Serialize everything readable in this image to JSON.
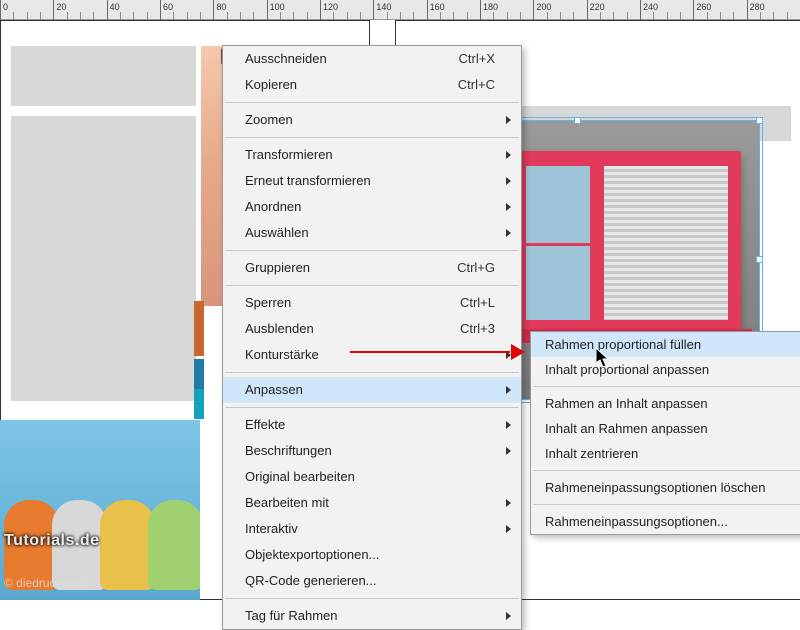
{
  "ruler_ticks": [
    0,
    20,
    40,
    60,
    80,
    100,
    120,
    140,
    160,
    180,
    200,
    220,
    240,
    260,
    280
  ],
  "context_menu": [
    {
      "label": "Ausschneiden",
      "shortcut": "Ctrl+X",
      "submenu": false
    },
    {
      "label": "Kopieren",
      "shortcut": "Ctrl+C",
      "submenu": false
    },
    {
      "type": "sep"
    },
    {
      "label": "Zoomen",
      "submenu": true
    },
    {
      "type": "sep"
    },
    {
      "label": "Transformieren",
      "submenu": true
    },
    {
      "label": "Erneut transformieren",
      "submenu": true
    },
    {
      "label": "Anordnen",
      "submenu": true
    },
    {
      "label": "Auswählen",
      "submenu": true
    },
    {
      "type": "sep"
    },
    {
      "label": "Gruppieren",
      "shortcut": "Ctrl+G",
      "submenu": false
    },
    {
      "type": "sep"
    },
    {
      "label": "Sperren",
      "shortcut": "Ctrl+L",
      "submenu": false
    },
    {
      "label": "Ausblenden",
      "shortcut": "Ctrl+3",
      "submenu": false
    },
    {
      "label": "Konturstärke",
      "submenu": true
    },
    {
      "type": "sep"
    },
    {
      "label": "Anpassen",
      "submenu": true,
      "highlight": true
    },
    {
      "type": "sep"
    },
    {
      "label": "Effekte",
      "submenu": true
    },
    {
      "label": "Beschriftungen",
      "submenu": true
    },
    {
      "label": "Original bearbeiten",
      "submenu": false
    },
    {
      "label": "Bearbeiten mit",
      "submenu": true
    },
    {
      "label": "Interaktiv",
      "submenu": true
    },
    {
      "label": "Objektexportoptionen...",
      "submenu": false
    },
    {
      "label": "QR-Code generieren...",
      "submenu": false
    },
    {
      "type": "sep"
    },
    {
      "label": "Tag für Rahmen",
      "submenu": true
    }
  ],
  "submenu_anpassen": [
    {
      "label": "Rahmen proportional füllen",
      "highlight": true
    },
    {
      "label": "Inhalt proportional anpassen"
    },
    {
      "type": "sep"
    },
    {
      "label": "Rahmen an Inhalt anpassen"
    },
    {
      "label": "Inhalt an Rahmen anpassen"
    },
    {
      "label": "Inhalt zentrieren"
    },
    {
      "type": "sep"
    },
    {
      "label": "Rahmeneinpassungsoptionen löschen"
    },
    {
      "type": "sep"
    },
    {
      "label": "Rahmeneinpassungsoptionen..."
    }
  ],
  "watermarks": {
    "tutorials": "Tutorials.de",
    "diedruckerei": "© diedruckerei"
  }
}
